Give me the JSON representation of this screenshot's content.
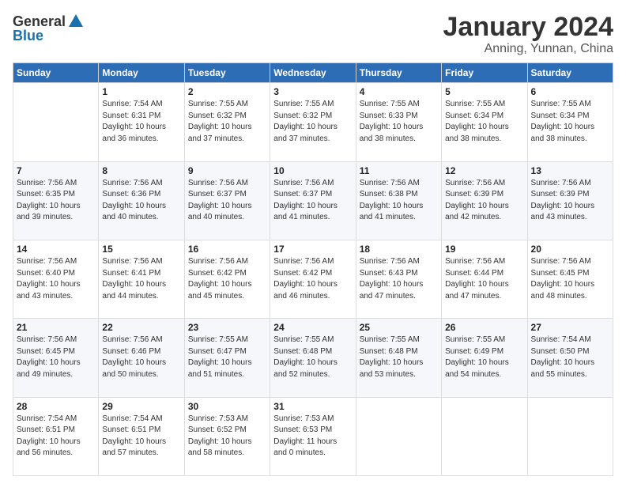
{
  "header": {
    "logo_general": "General",
    "logo_blue": "Blue",
    "month_title": "January 2024",
    "location": "Anning, Yunnan, China"
  },
  "weekdays": [
    "Sunday",
    "Monday",
    "Tuesday",
    "Wednesday",
    "Thursday",
    "Friday",
    "Saturday"
  ],
  "weeks": [
    [
      {
        "day": "",
        "sunrise": "",
        "sunset": "",
        "daylight": ""
      },
      {
        "day": "1",
        "sunrise": "Sunrise: 7:54 AM",
        "sunset": "Sunset: 6:31 PM",
        "daylight": "Daylight: 10 hours and 36 minutes."
      },
      {
        "day": "2",
        "sunrise": "Sunrise: 7:55 AM",
        "sunset": "Sunset: 6:32 PM",
        "daylight": "Daylight: 10 hours and 37 minutes."
      },
      {
        "day": "3",
        "sunrise": "Sunrise: 7:55 AM",
        "sunset": "Sunset: 6:32 PM",
        "daylight": "Daylight: 10 hours and 37 minutes."
      },
      {
        "day": "4",
        "sunrise": "Sunrise: 7:55 AM",
        "sunset": "Sunset: 6:33 PM",
        "daylight": "Daylight: 10 hours and 38 minutes."
      },
      {
        "day": "5",
        "sunrise": "Sunrise: 7:55 AM",
        "sunset": "Sunset: 6:34 PM",
        "daylight": "Daylight: 10 hours and 38 minutes."
      },
      {
        "day": "6",
        "sunrise": "Sunrise: 7:55 AM",
        "sunset": "Sunset: 6:34 PM",
        "daylight": "Daylight: 10 hours and 38 minutes."
      }
    ],
    [
      {
        "day": "7",
        "sunrise": "Sunrise: 7:56 AM",
        "sunset": "Sunset: 6:35 PM",
        "daylight": "Daylight: 10 hours and 39 minutes."
      },
      {
        "day": "8",
        "sunrise": "Sunrise: 7:56 AM",
        "sunset": "Sunset: 6:36 PM",
        "daylight": "Daylight: 10 hours and 40 minutes."
      },
      {
        "day": "9",
        "sunrise": "Sunrise: 7:56 AM",
        "sunset": "Sunset: 6:37 PM",
        "daylight": "Daylight: 10 hours and 40 minutes."
      },
      {
        "day": "10",
        "sunrise": "Sunrise: 7:56 AM",
        "sunset": "Sunset: 6:37 PM",
        "daylight": "Daylight: 10 hours and 41 minutes."
      },
      {
        "day": "11",
        "sunrise": "Sunrise: 7:56 AM",
        "sunset": "Sunset: 6:38 PM",
        "daylight": "Daylight: 10 hours and 41 minutes."
      },
      {
        "day": "12",
        "sunrise": "Sunrise: 7:56 AM",
        "sunset": "Sunset: 6:39 PM",
        "daylight": "Daylight: 10 hours and 42 minutes."
      },
      {
        "day": "13",
        "sunrise": "Sunrise: 7:56 AM",
        "sunset": "Sunset: 6:39 PM",
        "daylight": "Daylight: 10 hours and 43 minutes."
      }
    ],
    [
      {
        "day": "14",
        "sunrise": "Sunrise: 7:56 AM",
        "sunset": "Sunset: 6:40 PM",
        "daylight": "Daylight: 10 hours and 43 minutes."
      },
      {
        "day": "15",
        "sunrise": "Sunrise: 7:56 AM",
        "sunset": "Sunset: 6:41 PM",
        "daylight": "Daylight: 10 hours and 44 minutes."
      },
      {
        "day": "16",
        "sunrise": "Sunrise: 7:56 AM",
        "sunset": "Sunset: 6:42 PM",
        "daylight": "Daylight: 10 hours and 45 minutes."
      },
      {
        "day": "17",
        "sunrise": "Sunrise: 7:56 AM",
        "sunset": "Sunset: 6:42 PM",
        "daylight": "Daylight: 10 hours and 46 minutes."
      },
      {
        "day": "18",
        "sunrise": "Sunrise: 7:56 AM",
        "sunset": "Sunset: 6:43 PM",
        "daylight": "Daylight: 10 hours and 47 minutes."
      },
      {
        "day": "19",
        "sunrise": "Sunrise: 7:56 AM",
        "sunset": "Sunset: 6:44 PM",
        "daylight": "Daylight: 10 hours and 47 minutes."
      },
      {
        "day": "20",
        "sunrise": "Sunrise: 7:56 AM",
        "sunset": "Sunset: 6:45 PM",
        "daylight": "Daylight: 10 hours and 48 minutes."
      }
    ],
    [
      {
        "day": "21",
        "sunrise": "Sunrise: 7:56 AM",
        "sunset": "Sunset: 6:45 PM",
        "daylight": "Daylight: 10 hours and 49 minutes."
      },
      {
        "day": "22",
        "sunrise": "Sunrise: 7:56 AM",
        "sunset": "Sunset: 6:46 PM",
        "daylight": "Daylight: 10 hours and 50 minutes."
      },
      {
        "day": "23",
        "sunrise": "Sunrise: 7:55 AM",
        "sunset": "Sunset: 6:47 PM",
        "daylight": "Daylight: 10 hours and 51 minutes."
      },
      {
        "day": "24",
        "sunrise": "Sunrise: 7:55 AM",
        "sunset": "Sunset: 6:48 PM",
        "daylight": "Daylight: 10 hours and 52 minutes."
      },
      {
        "day": "25",
        "sunrise": "Sunrise: 7:55 AM",
        "sunset": "Sunset: 6:48 PM",
        "daylight": "Daylight: 10 hours and 53 minutes."
      },
      {
        "day": "26",
        "sunrise": "Sunrise: 7:55 AM",
        "sunset": "Sunset: 6:49 PM",
        "daylight": "Daylight: 10 hours and 54 minutes."
      },
      {
        "day": "27",
        "sunrise": "Sunrise: 7:54 AM",
        "sunset": "Sunset: 6:50 PM",
        "daylight": "Daylight: 10 hours and 55 minutes."
      }
    ],
    [
      {
        "day": "28",
        "sunrise": "Sunrise: 7:54 AM",
        "sunset": "Sunset: 6:51 PM",
        "daylight": "Daylight: 10 hours and 56 minutes."
      },
      {
        "day": "29",
        "sunrise": "Sunrise: 7:54 AM",
        "sunset": "Sunset: 6:51 PM",
        "daylight": "Daylight: 10 hours and 57 minutes."
      },
      {
        "day": "30",
        "sunrise": "Sunrise: 7:53 AM",
        "sunset": "Sunset: 6:52 PM",
        "daylight": "Daylight: 10 hours and 58 minutes."
      },
      {
        "day": "31",
        "sunrise": "Sunrise: 7:53 AM",
        "sunset": "Sunset: 6:53 PM",
        "daylight": "Daylight: 11 hours and 0 minutes."
      },
      {
        "day": "",
        "sunrise": "",
        "sunset": "",
        "daylight": ""
      },
      {
        "day": "",
        "sunrise": "",
        "sunset": "",
        "daylight": ""
      },
      {
        "day": "",
        "sunrise": "",
        "sunset": "",
        "daylight": ""
      }
    ]
  ]
}
